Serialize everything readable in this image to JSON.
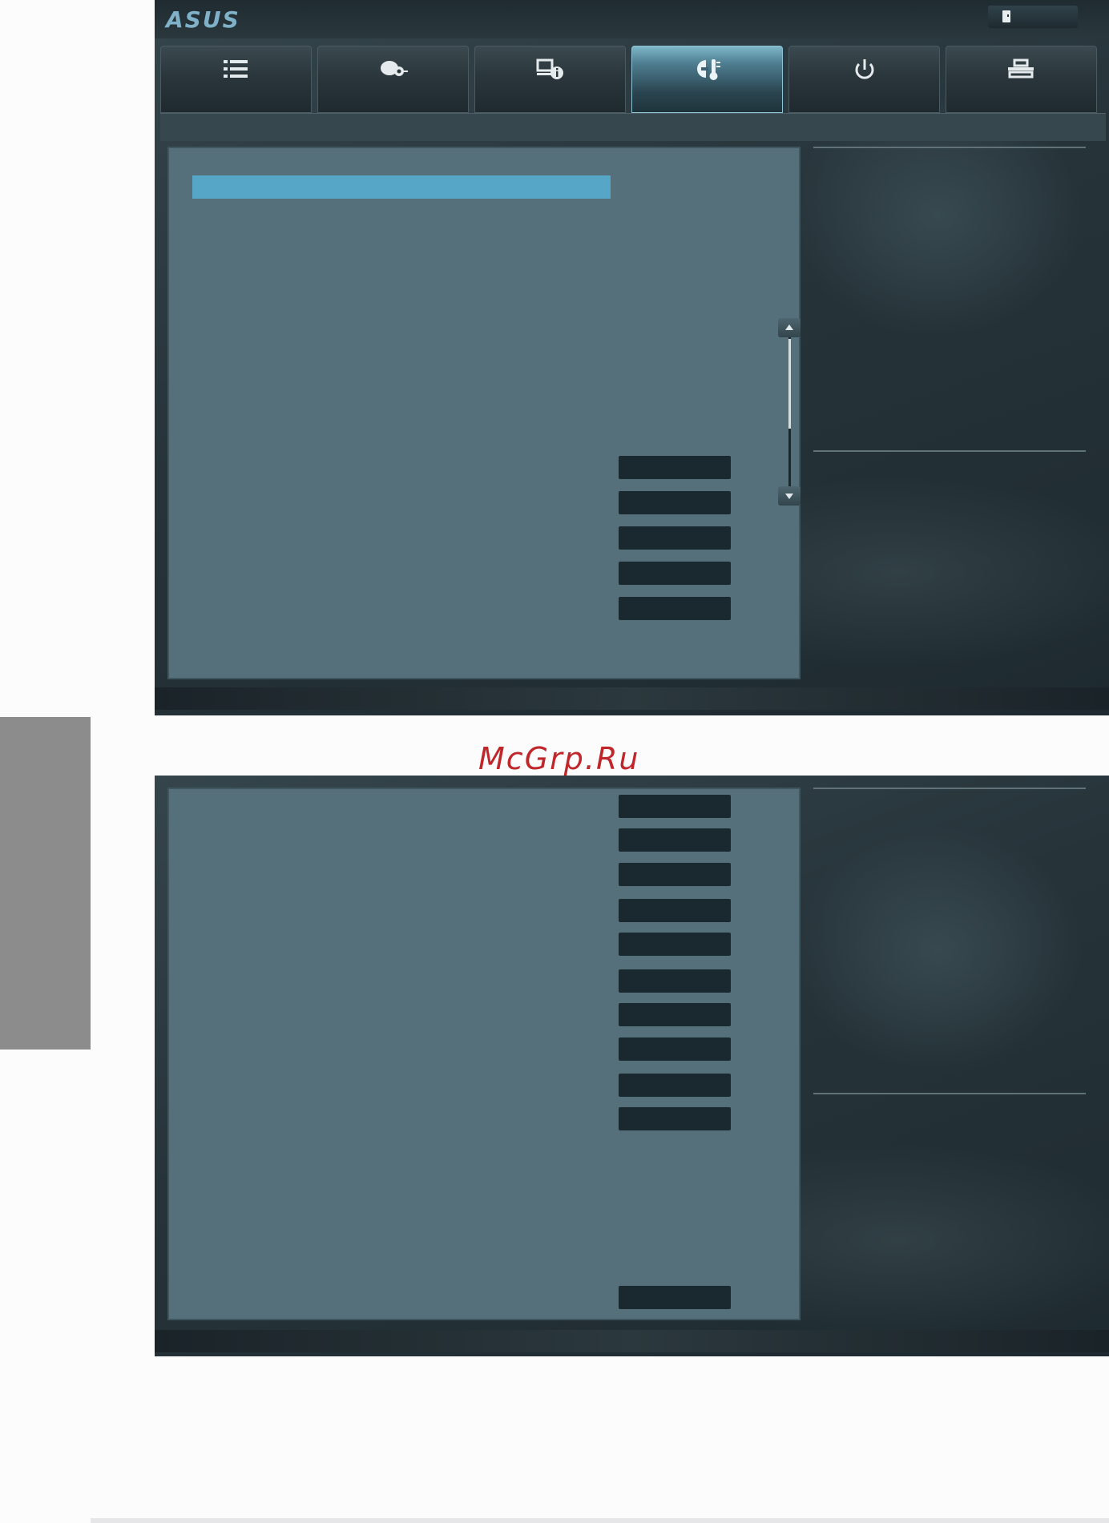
{
  "brand": {
    "logo_text": "ASUS"
  },
  "tabs": [
    {
      "icon": "list-icon",
      "active": false
    },
    {
      "icon": "ai-tweaker-icon",
      "active": false
    },
    {
      "icon": "advanced-icon",
      "active": false
    },
    {
      "icon": "monitor-icon",
      "active": true
    },
    {
      "icon": "power-icon",
      "active": false
    },
    {
      "icon": "tool-icon",
      "active": false
    }
  ],
  "topbar": {
    "exit_icon": "exit-icon"
  },
  "colors": {
    "accent": "#56a6c7",
    "panel": "#56707b",
    "option_box": "#1a2830",
    "watermark": "#c0262a",
    "side_tab": "#8c8c8c"
  },
  "upper_screen": {
    "options": [
      "",
      "",
      "",
      "",
      ""
    ]
  },
  "lower_screen": {
    "options": [
      "",
      "",
      "",
      "",
      "",
      "",
      "",
      "",
      "",
      "",
      ""
    ]
  },
  "watermark": {
    "text": "McGrp.Ru"
  }
}
